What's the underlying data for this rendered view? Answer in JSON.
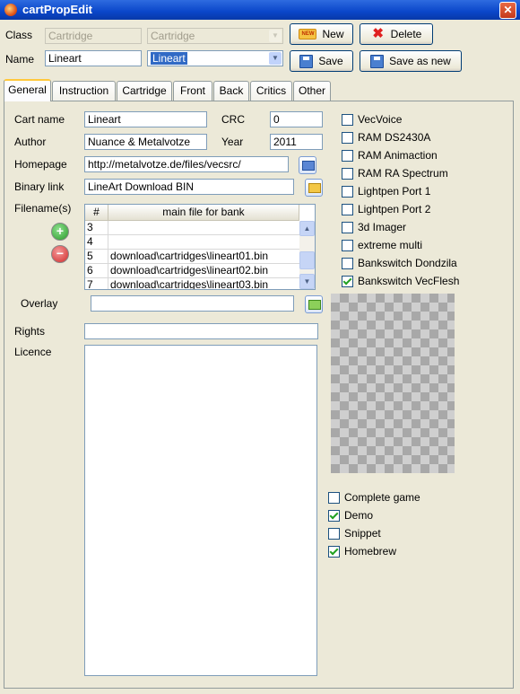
{
  "window": {
    "title": "cartPropEdit",
    "close": "✕"
  },
  "top": {
    "class_label": "Class",
    "class_value": "Cartridge",
    "class_combo": "Cartridge",
    "name_label": "Name",
    "name_value": "Lineart",
    "name_combo": "Lineart",
    "new_label": "New",
    "new_icon_text": "NEW",
    "delete_label": "Delete",
    "save_label": "Save",
    "saveas_label": "Save as new"
  },
  "tabs": [
    "General",
    "Instruction",
    "Cartridge",
    "Front",
    "Back",
    "Critics",
    "Other"
  ],
  "general": {
    "cart_name_label": "Cart name",
    "cart_name_value": "Lineart",
    "crc_label": "CRC",
    "crc_value": "0",
    "author_label": "Author",
    "author_value": "Nuance & Metalvotze",
    "year_label": "Year",
    "year_value": "2011",
    "homepage_label": "Homepage",
    "homepage_value": "http://metalvotze.de/files/vecsrc/",
    "binary_label": "Binary link",
    "binary_value": "LineArt Download BIN",
    "filenames_label": "Filename(s)",
    "overlay_label": "Overlay",
    "overlay_value": "",
    "rights_label": "Rights",
    "rights_value": "",
    "licence_label": "Licence"
  },
  "table": {
    "headers": [
      "#",
      "main file for bank"
    ],
    "rows": [
      {
        "num": "3",
        "file": ""
      },
      {
        "num": "4",
        "file": ""
      },
      {
        "num": "5",
        "file": "download\\cartridges\\lineart01.bin"
      },
      {
        "num": "6",
        "file": "download\\cartridges\\lineart02.bin"
      },
      {
        "num": "7",
        "file": "download\\cartridges\\lineart03.bin"
      }
    ]
  },
  "hardware": [
    {
      "label": "VecVoice",
      "checked": false
    },
    {
      "label": "RAM DS2430A",
      "checked": false
    },
    {
      "label": "RAM Animaction",
      "checked": false
    },
    {
      "label": "RAM RA Spectrum",
      "checked": false
    },
    {
      "label": "Lightpen Port 1",
      "checked": false
    },
    {
      "label": "Lightpen Port 2",
      "checked": false
    },
    {
      "label": "3d Imager",
      "checked": false
    },
    {
      "label": "extreme multi",
      "checked": false
    },
    {
      "label": "Bankswitch Dondzila",
      "checked": false
    },
    {
      "label": "Bankswitch VecFlesh",
      "checked": true
    }
  ],
  "type_flags": [
    {
      "label": "Complete game",
      "checked": false
    },
    {
      "label": "Demo",
      "checked": true
    },
    {
      "label": "Snippet",
      "checked": false
    },
    {
      "label": "Homebrew",
      "checked": true
    }
  ],
  "colors": {
    "titlebar": "#0a46c9",
    "accent": "#316ac5",
    "check": "#21a121"
  }
}
